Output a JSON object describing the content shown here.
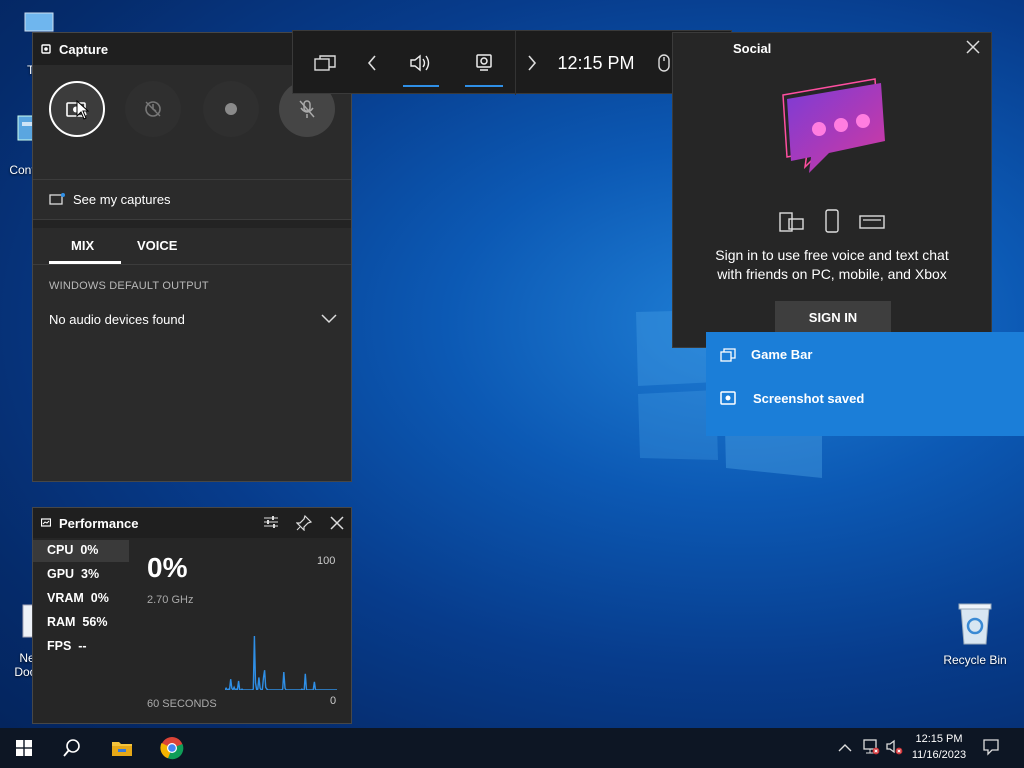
{
  "desktop": {
    "icons": [
      {
        "label": "Th"
      },
      {
        "label": "Contr"
      },
      {
        "label": "Ne"
      },
      {
        "label": "Doc"
      },
      {
        "label": "Recycle Bin"
      }
    ]
  },
  "capture": {
    "title": "Capture",
    "see_captures": "See my captures",
    "tabs": [
      "MIX",
      "VOICE"
    ],
    "output_label": "WINDOWS DEFAULT OUTPUT",
    "output_value": "No audio devices found"
  },
  "topbar": {
    "time": "12:15 PM"
  },
  "social": {
    "title": "Social",
    "message_line1": "Sign in to use free voice and text chat",
    "message_line2": "with friends on PC, mobile, and Xbox",
    "sign_in": "SIGN IN"
  },
  "toast": {
    "app_name": "Game Bar",
    "message": "Screenshot saved"
  },
  "performance": {
    "title": "Performance",
    "metrics": [
      {
        "name": "CPU",
        "value": "0%"
      },
      {
        "name": "GPU",
        "value": "3%"
      },
      {
        "name": "VRAM",
        "value": "0%"
      },
      {
        "name": "RAM",
        "value": "56%"
      },
      {
        "name": "FPS",
        "value": "--"
      }
    ],
    "big_value": "0%",
    "freq": "2.70 GHz",
    "max": "100",
    "min": "0",
    "time_span": "60 SECONDS",
    "graph_color": "#2f8fe6",
    "chart_data": {
      "type": "line",
      "title": "",
      "xlabel": "60 SECONDS",
      "ylabel": "",
      "ylim": [
        0,
        100
      ],
      "values": [
        0,
        2,
        0,
        1,
        0,
        12,
        2,
        0,
        3,
        0,
        1,
        0,
        10,
        0,
        0,
        1,
        0,
        0,
        0,
        0,
        0,
        0,
        0,
        0,
        0,
        1,
        60,
        8,
        0,
        1,
        14,
        2,
        0,
        0,
        14,
        22,
        3,
        1,
        0,
        0,
        0,
        0,
        0,
        0,
        0,
        0,
        0,
        0,
        0,
        0,
        0,
        1,
        20,
        2,
        0,
        0,
        0,
        0,
        0,
        0,
        0,
        0,
        0,
        0,
        0,
        0,
        0,
        0,
        1,
        0,
        0,
        18,
        0,
        0,
        0,
        0,
        0,
        0,
        0,
        9,
        0,
        0,
        0,
        0,
        0,
        0,
        0,
        0,
        0,
        0,
        0,
        0,
        0,
        0,
        0,
        0,
        0,
        0,
        0,
        0
      ]
    }
  },
  "taskbar": {
    "clock_time": "12:15 PM",
    "clock_date": "11/16/2023"
  },
  "colors": {
    "accent": "#2f8fe6",
    "toast": "#1b7ed8",
    "panel": "#2b2b2b"
  }
}
